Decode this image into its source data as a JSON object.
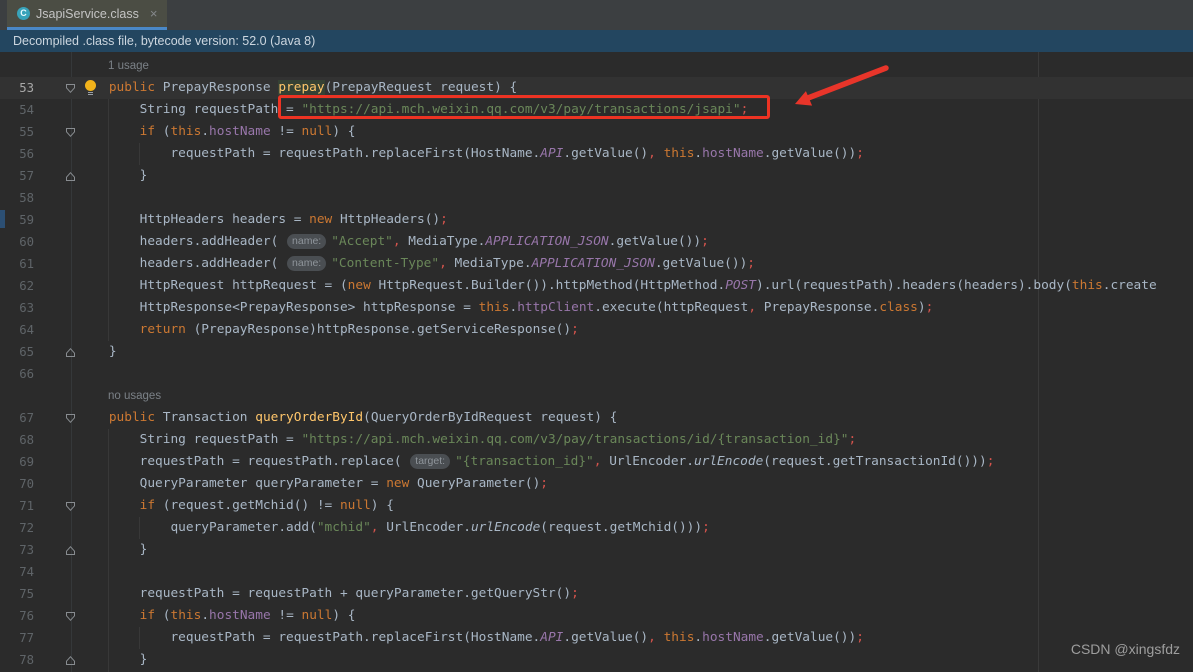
{
  "tab": {
    "title": "JsapiService.class",
    "icon_letter": "C",
    "close_glyph": "×"
  },
  "banner": {
    "text": "Decompiled .class file, bytecode version: 52.0 (Java 8)"
  },
  "watermark": {
    "text": "CSDN @xingsfdz"
  },
  "colors": {
    "editor_bg": "#2b2b2b",
    "tabbar_bg": "#3c3f41",
    "active_tab_bg": "#4b4d44",
    "tab_underline": "#4a88c7",
    "banner_bg": "#234660",
    "caret_row_bg": "#323232",
    "keyword": "#cc7832",
    "string": "#6a8759",
    "method_decl": "#ffc66b",
    "constant": "#9876aa",
    "field": "#9876aa",
    "default_text": "#a9b7c6",
    "punctuation": "#d5544d",
    "line_number": "#5f6468",
    "annotation_red": "#ec3323"
  },
  "editor": {
    "first_line_number": 53,
    "last_line_number": 78,
    "rows": [
      {
        "n": "",
        "fold": "",
        "tokens": [
          [
            "vision",
            "1 usage"
          ]
        ]
      },
      {
        "n": "53",
        "fold": "down",
        "bulb": true,
        "current": true,
        "tokens": [
          [
            "txt",
            "    "
          ],
          [
            "kw",
            "public"
          ],
          [
            "txt",
            " PrepayResponse "
          ],
          [
            "mthhl",
            "prepay"
          ],
          [
            "txt",
            "(PrepayRequest request) {"
          ]
        ]
      },
      {
        "n": "54",
        "fold": "",
        "tokens": [
          [
            "txt",
            "        String requestPath = "
          ],
          [
            "str",
            "\"https://api.mch.weixin.qq.com/v3/pay/transactions/jsapi\""
          ],
          [
            "pun",
            ";"
          ]
        ]
      },
      {
        "n": "55",
        "fold": "down",
        "tokens": [
          [
            "txt",
            "        "
          ],
          [
            "kw",
            "if"
          ],
          [
            "txt",
            " ("
          ],
          [
            "kw",
            "this"
          ],
          [
            "txt",
            "."
          ],
          [
            "fld",
            "hostName"
          ],
          [
            "txt",
            " != "
          ],
          [
            "kw",
            "null"
          ],
          [
            "txt",
            ") {"
          ]
        ]
      },
      {
        "n": "56",
        "fold": "",
        "tokens": [
          [
            "txt",
            "            requestPath = requestPath.replaceFirst(HostName."
          ],
          [
            "con",
            "API"
          ],
          [
            "txt",
            ".getValue()"
          ],
          [
            "pun",
            ","
          ],
          [
            "txt",
            " "
          ],
          [
            "kw",
            "this"
          ],
          [
            "txt",
            "."
          ],
          [
            "fld",
            "hostName"
          ],
          [
            "txt",
            ".getValue())"
          ],
          [
            "pun",
            ";"
          ]
        ]
      },
      {
        "n": "57",
        "fold": "up",
        "tokens": [
          [
            "txt",
            "        }"
          ]
        ]
      },
      {
        "n": "58",
        "fold": "",
        "tokens": []
      },
      {
        "n": "59",
        "fold": "",
        "tokens": [
          [
            "txt",
            "        HttpHeaders headers = "
          ],
          [
            "kw",
            "new"
          ],
          [
            "txt",
            " HttpHeaders()"
          ],
          [
            "pun",
            ";"
          ]
        ]
      },
      {
        "n": "60",
        "fold": "",
        "tokens": [
          [
            "txt",
            "        headers.addHeader( "
          ],
          [
            "hint",
            "name:"
          ],
          [
            "str",
            "\"Accept\""
          ],
          [
            "pun",
            ","
          ],
          [
            "txt",
            " MediaType."
          ],
          [
            "con",
            "APPLICATION_JSON"
          ],
          [
            "txt",
            ".getValue())"
          ],
          [
            "pun",
            ";"
          ]
        ]
      },
      {
        "n": "61",
        "fold": "",
        "tokens": [
          [
            "txt",
            "        headers.addHeader( "
          ],
          [
            "hint",
            "name:"
          ],
          [
            "str",
            "\"Content-Type\""
          ],
          [
            "pun",
            ","
          ],
          [
            "txt",
            " MediaType."
          ],
          [
            "con",
            "APPLICATION_JSON"
          ],
          [
            "txt",
            ".getValue())"
          ],
          [
            "pun",
            ";"
          ]
        ]
      },
      {
        "n": "62",
        "fold": "",
        "tokens": [
          [
            "txt",
            "        HttpRequest httpRequest = ("
          ],
          [
            "kw",
            "new"
          ],
          [
            "txt",
            " HttpRequest.Builder()).httpMethod(HttpMethod."
          ],
          [
            "con",
            "POST"
          ],
          [
            "txt",
            ").url(requestPath).headers(headers).body("
          ],
          [
            "kw",
            "this"
          ],
          [
            "txt",
            ".create"
          ]
        ]
      },
      {
        "n": "63",
        "fold": "",
        "tokens": [
          [
            "txt",
            "        HttpResponse<PrepayResponse> httpResponse = "
          ],
          [
            "kw",
            "this"
          ],
          [
            "txt",
            "."
          ],
          [
            "fld",
            "httpClient"
          ],
          [
            "txt",
            ".execute(httpRequest"
          ],
          [
            "pun",
            ","
          ],
          [
            "txt",
            " PrepayResponse."
          ],
          [
            "kw",
            "class"
          ],
          [
            "txt",
            ")"
          ],
          [
            "pun",
            ";"
          ]
        ]
      },
      {
        "n": "64",
        "fold": "",
        "tokens": [
          [
            "txt",
            "        "
          ],
          [
            "kw",
            "return"
          ],
          [
            "txt",
            " (PrepayResponse)httpResponse.getServiceResponse()"
          ],
          [
            "pun",
            ";"
          ]
        ]
      },
      {
        "n": "65",
        "fold": "up",
        "tokens": [
          [
            "txt",
            "    }"
          ]
        ]
      },
      {
        "n": "66",
        "fold": "",
        "tokens": []
      },
      {
        "n": "",
        "fold": "",
        "tokens": [
          [
            "vision",
            "no usages"
          ]
        ]
      },
      {
        "n": "67",
        "fold": "down",
        "tokens": [
          [
            "txt",
            "    "
          ],
          [
            "kw",
            "public"
          ],
          [
            "txt",
            " Transaction "
          ],
          [
            "mth",
            "queryOrderById"
          ],
          [
            "txt",
            "(QueryOrderByIdRequest request) {"
          ]
        ]
      },
      {
        "n": "68",
        "fold": "",
        "tokens": [
          [
            "txt",
            "        String requestPath = "
          ],
          [
            "str",
            "\"https://api.mch.weixin.qq.com/v3/pay/transactions/id/{transaction_id}\""
          ],
          [
            "pun",
            ";"
          ]
        ]
      },
      {
        "n": "69",
        "fold": "",
        "tokens": [
          [
            "txt",
            "        requestPath = requestPath.replace( "
          ],
          [
            "hint",
            "target:"
          ],
          [
            "str",
            "\"{transaction_id}\""
          ],
          [
            "pun",
            ","
          ],
          [
            "txt",
            " UrlEncoder."
          ],
          [
            "itl",
            "urlEncode"
          ],
          [
            "txt",
            "(request.getTransactionId()))"
          ],
          [
            "pun",
            ";"
          ]
        ]
      },
      {
        "n": "70",
        "fold": "",
        "tokens": [
          [
            "txt",
            "        QueryParameter queryParameter = "
          ],
          [
            "kw",
            "new"
          ],
          [
            "txt",
            " QueryParameter()"
          ],
          [
            "pun",
            ";"
          ]
        ]
      },
      {
        "n": "71",
        "fold": "down",
        "tokens": [
          [
            "txt",
            "        "
          ],
          [
            "kw",
            "if"
          ],
          [
            "txt",
            " (request.getMchid() != "
          ],
          [
            "kw",
            "null"
          ],
          [
            "txt",
            ") {"
          ]
        ]
      },
      {
        "n": "72",
        "fold": "",
        "tokens": [
          [
            "txt",
            "            queryParameter.add("
          ],
          [
            "str",
            "\"mchid\""
          ],
          [
            "pun",
            ","
          ],
          [
            "txt",
            " UrlEncoder."
          ],
          [
            "itl",
            "urlEncode"
          ],
          [
            "txt",
            "(request.getMchid()))"
          ],
          [
            "pun",
            ";"
          ]
        ]
      },
      {
        "n": "73",
        "fold": "up",
        "tokens": [
          [
            "txt",
            "        }"
          ]
        ]
      },
      {
        "n": "74",
        "fold": "",
        "tokens": []
      },
      {
        "n": "75",
        "fold": "",
        "tokens": [
          [
            "txt",
            "        requestPath = requestPath + queryParameter.getQueryStr()"
          ],
          [
            "pun",
            ";"
          ]
        ]
      },
      {
        "n": "76",
        "fold": "down",
        "tokens": [
          [
            "txt",
            "        "
          ],
          [
            "kw",
            "if"
          ],
          [
            "txt",
            " ("
          ],
          [
            "kw",
            "this"
          ],
          [
            "txt",
            "."
          ],
          [
            "fld",
            "hostName"
          ],
          [
            "txt",
            " != "
          ],
          [
            "kw",
            "null"
          ],
          [
            "txt",
            ") {"
          ]
        ]
      },
      {
        "n": "77",
        "fold": "",
        "tokens": [
          [
            "txt",
            "            requestPath = requestPath.replaceFirst(HostName."
          ],
          [
            "con",
            "API"
          ],
          [
            "txt",
            ".getValue()"
          ],
          [
            "pun",
            ","
          ],
          [
            "txt",
            " "
          ],
          [
            "kw",
            "this"
          ],
          [
            "txt",
            "."
          ],
          [
            "fld",
            "hostName"
          ],
          [
            "txt",
            ".getValue())"
          ],
          [
            "pun",
            ";"
          ]
        ]
      },
      {
        "n": "78",
        "fold": "up",
        "tokens": [
          [
            "txt",
            "        }"
          ]
        ]
      }
    ]
  }
}
